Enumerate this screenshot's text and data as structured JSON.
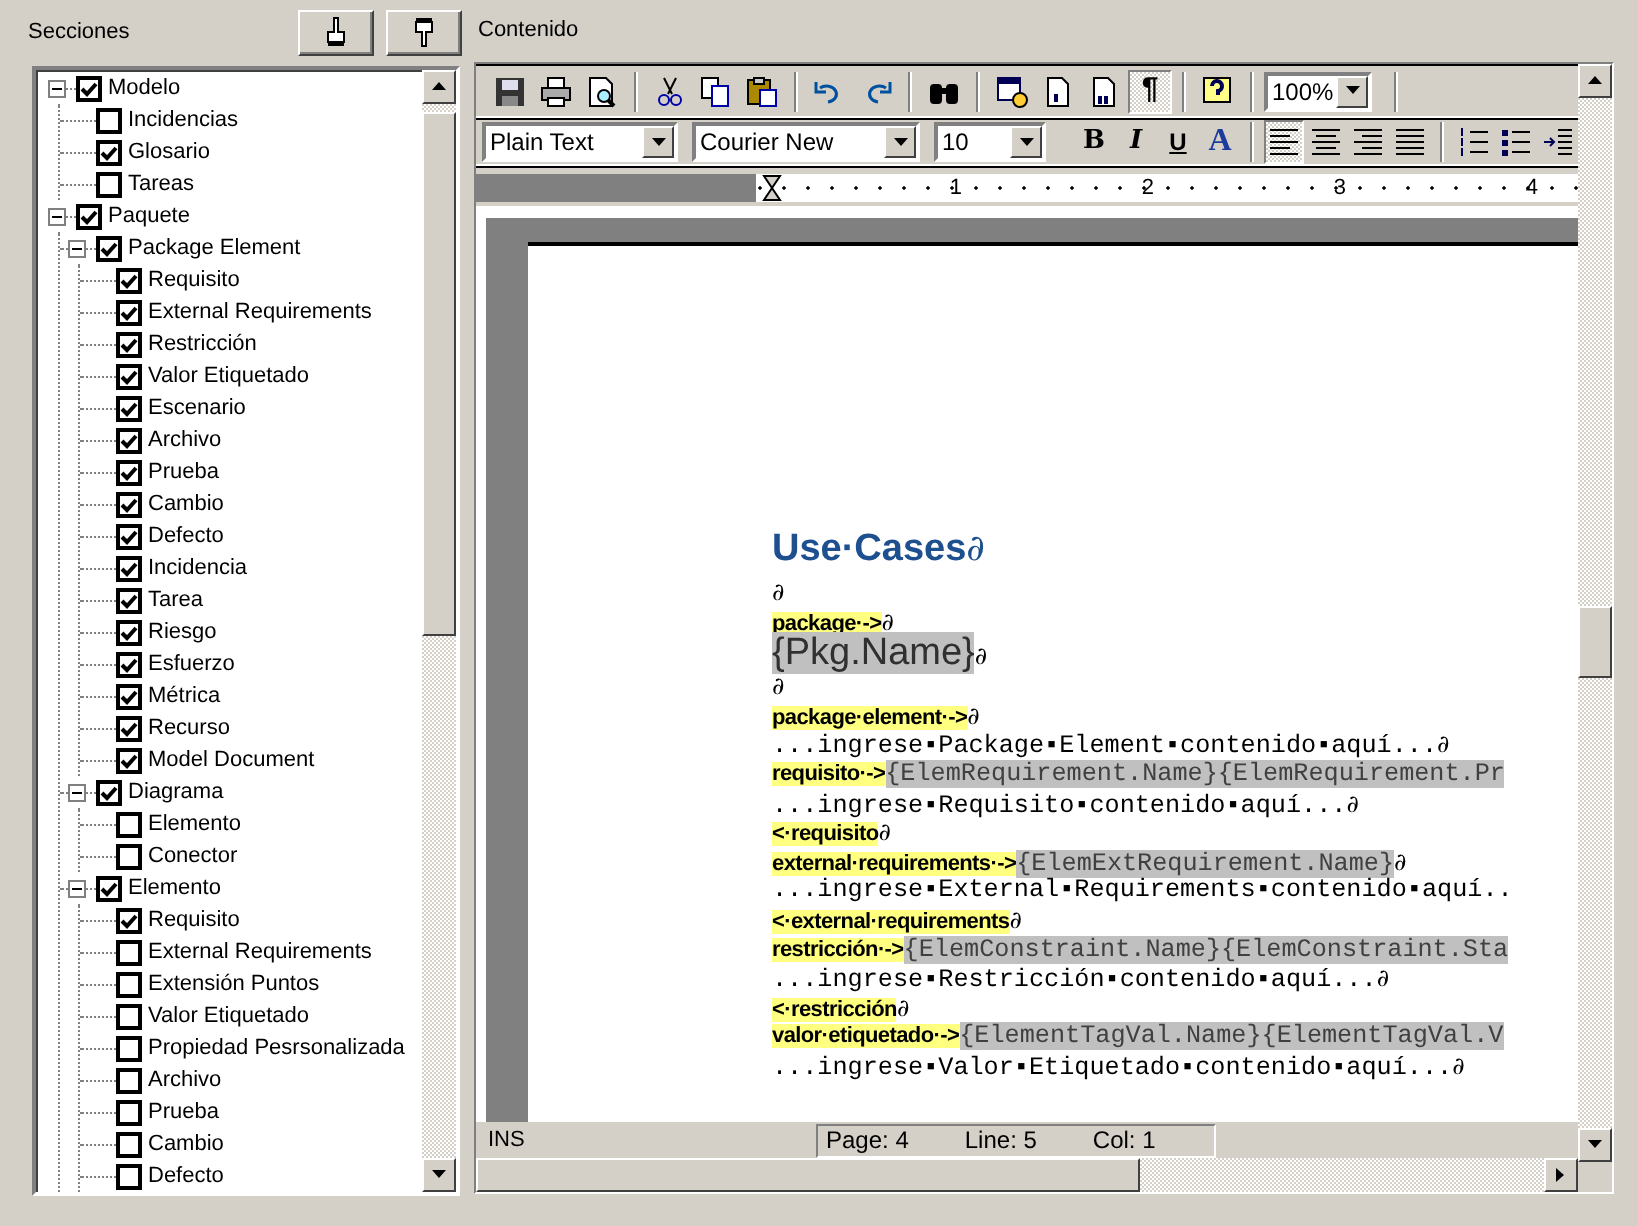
{
  "left_panel": {
    "title": "Secciones",
    "buttons": [
      {
        "kind": "move-up"
      },
      {
        "kind": "move-down"
      }
    ]
  },
  "tree": [
    {
      "label": "Modelo",
      "checked": true,
      "expanded": true,
      "children": [
        {
          "label": "Incidencias",
          "checked": false
        },
        {
          "label": "Glosario",
          "checked": true
        },
        {
          "label": "Tareas",
          "checked": false
        }
      ]
    },
    {
      "label": "Paquete",
      "checked": true,
      "expanded": true,
      "children": [
        {
          "label": "Package Element",
          "checked": true,
          "expanded": true,
          "children": [
            {
              "label": "Requisito",
              "checked": true
            },
            {
              "label": "External Requirements",
              "checked": true
            },
            {
              "label": "Restricción",
              "checked": true
            },
            {
              "label": "Valor Etiquetado",
              "checked": true
            },
            {
              "label": "Escenario",
              "checked": true
            },
            {
              "label": "Archivo",
              "checked": true
            },
            {
              "label": "Prueba",
              "checked": true
            },
            {
              "label": "Cambio",
              "checked": true
            },
            {
              "label": "Defecto",
              "checked": true
            },
            {
              "label": "Incidencia",
              "checked": true
            },
            {
              "label": "Tarea",
              "checked": true
            },
            {
              "label": "Riesgo",
              "checked": true
            },
            {
              "label": "Esfuerzo",
              "checked": true
            },
            {
              "label": "Métrica",
              "checked": true
            },
            {
              "label": "Recurso",
              "checked": true
            },
            {
              "label": "Model Document",
              "checked": true
            }
          ]
        },
        {
          "label": "Diagrama",
          "checked": true,
          "expanded": true,
          "children": [
            {
              "label": "Elemento",
              "checked": false
            },
            {
              "label": "Conector",
              "checked": false
            }
          ]
        },
        {
          "label": "Elemento",
          "checked": true,
          "expanded": true,
          "children": [
            {
              "label": "Requisito",
              "checked": true
            },
            {
              "label": "External Requirements",
              "checked": false
            },
            {
              "label": "Extensión Puntos",
              "checked": false
            },
            {
              "label": "Valor Etiquetado",
              "checked": false
            },
            {
              "label": "Propiedad Pesrsonalizada",
              "checked": false
            },
            {
              "label": "Archivo",
              "checked": false
            },
            {
              "label": "Prueba",
              "checked": false
            },
            {
              "label": "Cambio",
              "checked": false
            },
            {
              "label": "Defecto",
              "checked": false
            }
          ]
        }
      ]
    }
  ],
  "right_panel": {
    "title": "Contenido"
  },
  "toolbar_main": {
    "groups": [
      [
        {
          "kind": "save",
          "pressed": false
        },
        {
          "kind": "print",
          "pressed": false
        },
        {
          "kind": "preview",
          "pressed": false
        }
      ],
      [
        {
          "kind": "cut",
          "pressed": false
        },
        {
          "kind": "copy",
          "pressed": false
        },
        {
          "kind": "paste",
          "pressed": false
        }
      ],
      [
        {
          "kind": "undo",
          "pressed": false
        },
        {
          "kind": "redo",
          "pressed": false
        }
      ],
      [
        {
          "kind": "find",
          "pressed": false
        }
      ],
      [
        {
          "kind": "insert-field",
          "pressed": false
        },
        {
          "kind": "header",
          "pressed": false
        },
        {
          "kind": "footer",
          "pressed": false
        },
        {
          "kind": "text",
          "label": "¶",
          "pressed": true
        }
      ],
      [
        {
          "kind": "help",
          "pressed": false
        }
      ]
    ],
    "zoom": "100%"
  },
  "toolbar_format": {
    "style": "Plain Text",
    "font": "Courier New",
    "size": "10",
    "groups": [
      [
        {
          "kind": "bold",
          "label": "B",
          "pressed": false
        },
        {
          "kind": "italic",
          "label": "I",
          "pressed": false
        },
        {
          "kind": "underline",
          "label": "U",
          "pressed": false
        },
        {
          "kind": "color",
          "label": "A",
          "pressed": false
        }
      ],
      [
        {
          "kind": "align-left",
          "pressed": true
        },
        {
          "kind": "align-center",
          "pressed": false
        },
        {
          "kind": "align-right",
          "pressed": false
        },
        {
          "kind": "justify",
          "pressed": false
        }
      ],
      [
        {
          "kind": "numbered-list",
          "pressed": false
        },
        {
          "kind": "bullet-list",
          "pressed": false
        },
        {
          "kind": "indent",
          "pressed": false
        }
      ]
    ]
  },
  "ruler": {
    "labels": [
      "1",
      "2",
      "3",
      "4"
    ]
  },
  "document": {
    "lines": [
      {
        "kind": "heading",
        "segments": [
          {
            "kind": "heading",
            "text": "Use·Cases"
          },
          {
            "kind": "mark",
            "text": "∂"
          }
        ]
      },
      {
        "kind": "body",
        "segments": [
          {
            "kind": "mark",
            "text": "∂"
          }
        ]
      },
      {
        "kind": "body",
        "segments": [
          {
            "kind": "tag",
            "text": "package·->"
          },
          {
            "kind": "mark",
            "text": "∂"
          }
        ]
      },
      {
        "kind": "large",
        "segments": [
          {
            "kind": "field-large",
            "text": "{Pkg.Name}"
          },
          {
            "kind": "mark",
            "text": "∂"
          }
        ]
      },
      {
        "kind": "body",
        "segments": [
          {
            "kind": "mark",
            "text": "∂"
          }
        ]
      },
      {
        "kind": "body",
        "segments": [
          {
            "kind": "tag",
            "text": "package·element·->"
          },
          {
            "kind": "mark",
            "text": "∂"
          }
        ]
      },
      {
        "kind": "body",
        "segments": [
          {
            "kind": "text",
            "text": "...ingrese▪Package▪Element▪contenido▪aquí..."
          },
          {
            "kind": "mark",
            "text": "∂"
          }
        ]
      },
      {
        "kind": "body",
        "segments": [
          {
            "kind": "tag",
            "text": "requisito·->"
          },
          {
            "kind": "field",
            "text": "{ElemRequirement.Name}{ElemRequirement.Pr"
          }
        ]
      },
      {
        "kind": "body",
        "segments": [
          {
            "kind": "text",
            "text": "...ingrese▪Requisito▪contenido▪aquí..."
          },
          {
            "kind": "mark",
            "text": "∂"
          }
        ]
      },
      {
        "kind": "body",
        "segments": [
          {
            "kind": "tag",
            "text": "<·requisito"
          },
          {
            "kind": "mark",
            "text": "∂"
          }
        ]
      },
      {
        "kind": "body",
        "segments": [
          {
            "kind": "tag",
            "text": "external·requirements·->"
          },
          {
            "kind": "field",
            "text": "{ElemExtRequirement.Name}"
          },
          {
            "kind": "mark",
            "text": "∂"
          }
        ]
      },
      {
        "kind": "body",
        "segments": [
          {
            "kind": "text",
            "text": "...ingrese▪External▪Requirements▪contenido▪aquí.."
          }
        ]
      },
      {
        "kind": "body",
        "segments": [
          {
            "kind": "tag",
            "text": "<·external·requirements"
          },
          {
            "kind": "mark",
            "text": "∂"
          }
        ]
      },
      {
        "kind": "body",
        "segments": [
          {
            "kind": "tag",
            "text": "restricción·->"
          },
          {
            "kind": "field",
            "text": "{ElemConstraint.Name}{ElemConstraint.Sta"
          }
        ]
      },
      {
        "kind": "body",
        "segments": [
          {
            "kind": "text",
            "text": "...ingrese▪Restricción▪contenido▪aquí..."
          },
          {
            "kind": "mark",
            "text": "∂"
          }
        ]
      },
      {
        "kind": "body",
        "segments": [
          {
            "kind": "tag",
            "text": "<·restricción"
          },
          {
            "kind": "mark",
            "text": "∂"
          }
        ]
      },
      {
        "kind": "body",
        "segments": [
          {
            "kind": "tag",
            "text": "valor·etiquetado·->"
          },
          {
            "kind": "field",
            "text": "{ElementTagVal.Name}{ElementTagVal.V"
          }
        ]
      },
      {
        "kind": "body",
        "segments": [
          {
            "kind": "text",
            "text": "...ingrese▪Valor▪Etiquetado▪contenido▪aquí..."
          },
          {
            "kind": "mark",
            "text": "∂"
          }
        ]
      }
    ]
  },
  "status_bar": {
    "mode": "INS",
    "page": "Page: 4",
    "line": "Line: 5",
    "col": "Col: 1"
  }
}
